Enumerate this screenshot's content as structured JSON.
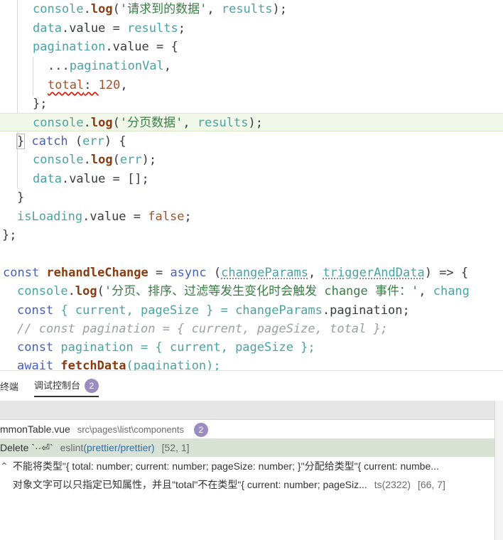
{
  "code": {
    "l1": {
      "a": "console",
      "b": ".",
      "c": "log",
      "d": "(",
      "e": "'请求到的数据'",
      "f": ", ",
      "g": "results",
      "h": ");"
    },
    "l2": {
      "a": "data",
      "b": ".value = ",
      "c": "results",
      "d": ";"
    },
    "l3": {
      "a": "pagination",
      "b": ".value = {"
    },
    "l4": {
      "a": "...",
      "b": "paginationVal",
      "c": ","
    },
    "l5": {
      "a": "total",
      "b": ": ",
      "c": "120",
      "d": ","
    },
    "l6": {
      "a": "};"
    },
    "l7": {
      "a": "console",
      "b": ".",
      "c": "log",
      "d": "(",
      "e": "'分页数据'",
      "f": ", ",
      "g": "results",
      "h": ");"
    },
    "l8": {
      "a": "}",
      "b": " catch ",
      "c": "(",
      "d": "err",
      "e": ") {"
    },
    "l9": {
      "a": "console",
      "b": ".",
      "c": "log",
      "d": "(",
      "e": "err",
      "f": ");"
    },
    "l10": {
      "a": "data",
      "b": ".value = [];"
    },
    "l11": {
      "a": "}"
    },
    "l12": {
      "a": "isLoading",
      "b": ".value = ",
      "c": "false",
      "d": ";"
    },
    "l13": {
      "a": "};"
    },
    "l14": {
      "a": "const ",
      "b": "rehandleChange",
      "c": " = ",
      "d": "async ",
      "e": "(",
      "f": "changeParams",
      "g": ", ",
      "h": "triggerAndData",
      "i": ") => {"
    },
    "l15": {
      "a": "console",
      "b": ".",
      "c": "log",
      "d": "(",
      "e": "'分页、排序、过滤等发生变化时会触发 change 事件：'",
      "f": ", ",
      "g": "chang"
    },
    "l16": {
      "a": "const ",
      "b": "{ current, pageSize } = ",
      "c": "changeParams",
      "d": ".pagination;"
    },
    "l17": {
      "a": "// const pagination = { current, pageSize, total };"
    },
    "l18": {
      "a": "const ",
      "b": "pagination",
      "c": " = { current, pageSize };"
    },
    "l19": {
      "a": "await ",
      "b": "fetchData",
      "c": "(pagination);"
    }
  },
  "panel": {
    "tab1": "终端",
    "tab2": "调试控制台",
    "tab2_badge": "2",
    "file": {
      "name": "mmonTable.vue",
      "path": "src\\pages\\list\\components",
      "badge": "2"
    },
    "problems": [
      {
        "text": "Delete `··⏎`",
        "source": "eslint",
        "link": "(prettier/prettier)",
        "pos": "[52, 1]"
      },
      {
        "text": "不能将类型\"{ total: number; current: number; pageSize: number; }\"分配给类型\"{ current: numbe..."
      },
      {
        "text": "对象文字可以只指定已知属性，并且\"total\"不在类型\"{ current: number; pageSiz...",
        "source": "ts(2322)",
        "pos": "[66, 7]"
      }
    ]
  },
  "colors": {
    "accent_badge": "#9c8cc0",
    "highlight": "#f1f8e9",
    "selected_row": "#d7e2d4"
  }
}
